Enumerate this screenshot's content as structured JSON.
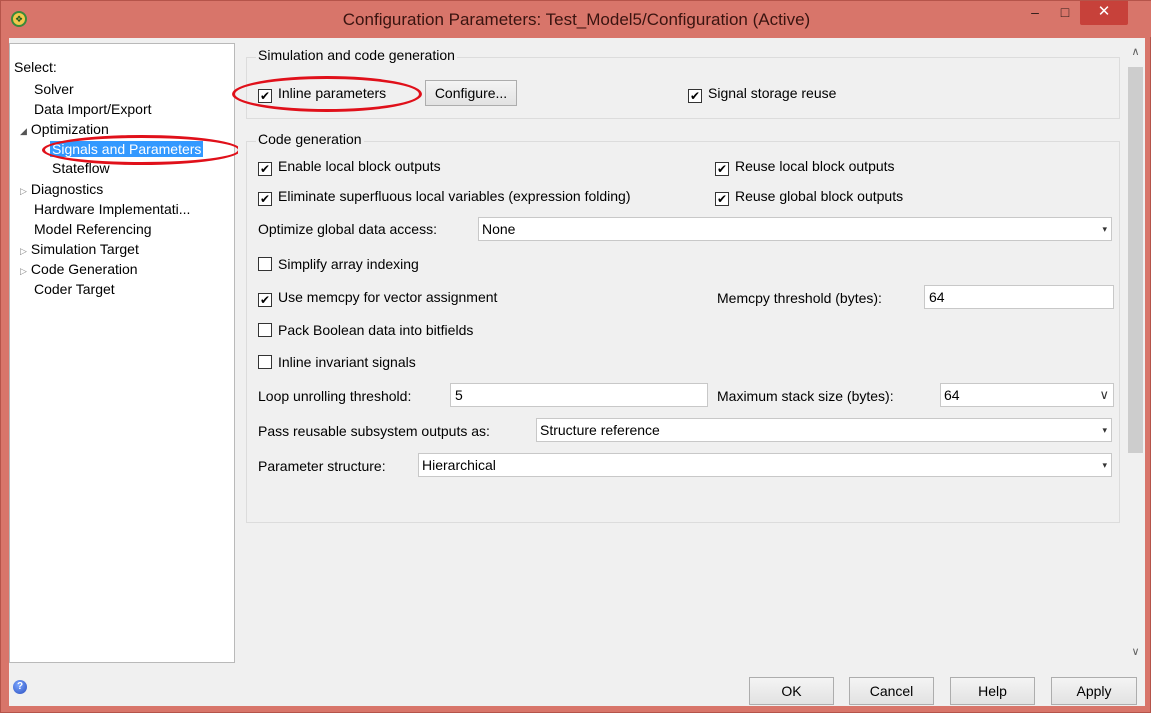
{
  "window": {
    "title": "Configuration Parameters: Test_Model5/Configuration (Active)",
    "minimize": "–",
    "maximize": "□",
    "close": "✕"
  },
  "tree": {
    "select_label": "Select:",
    "items": [
      {
        "label": "Solver",
        "indent": 0,
        "arrow": ""
      },
      {
        "label": "Data Import/Export",
        "indent": 0,
        "arrow": ""
      },
      {
        "label": "Optimization",
        "indent": 0,
        "arrow": "◢"
      },
      {
        "label": "Signals and Parameters",
        "indent": 1,
        "arrow": "",
        "selected": true
      },
      {
        "label": "Stateflow",
        "indent": 1,
        "arrow": ""
      },
      {
        "label": "Diagnostics",
        "indent": 0,
        "arrow": "▷"
      },
      {
        "label": "Hardware Implementati...",
        "indent": 0,
        "arrow": ""
      },
      {
        "label": "Model Referencing",
        "indent": 0,
        "arrow": ""
      },
      {
        "label": "Simulation Target",
        "indent": 0,
        "arrow": "▷"
      },
      {
        "label": "Code Generation",
        "indent": 0,
        "arrow": "▷"
      },
      {
        "label": "Coder Target",
        "indent": 0,
        "arrow": ""
      }
    ]
  },
  "sim_group": {
    "title": "Simulation and code generation",
    "inline_params": {
      "label": "Inline parameters",
      "checked": true
    },
    "configure_button": "Configure...",
    "signal_storage_reuse": {
      "label": "Signal storage reuse",
      "checked": true
    }
  },
  "code_group": {
    "title": "Code generation",
    "enable_local_block_outputs": {
      "label": "Enable local block outputs",
      "checked": true
    },
    "reuse_local_block_outputs": {
      "label": "Reuse local block outputs",
      "checked": true
    },
    "eliminate_superfluous": {
      "label": "Eliminate superfluous local variables (expression folding)",
      "checked": true
    },
    "reuse_global_block_outputs": {
      "label": "Reuse global block outputs",
      "checked": true
    },
    "optimize_global_label": "Optimize global data access:",
    "optimize_global_value": "None",
    "simplify_array_indexing": {
      "label": "Simplify array indexing",
      "checked": false
    },
    "use_memcpy": {
      "label": "Use memcpy for vector assignment",
      "checked": true
    },
    "memcpy_threshold_label": "Memcpy threshold (bytes):",
    "memcpy_threshold_value": "64",
    "pack_boolean": {
      "label": "Pack Boolean data into bitfields",
      "checked": false
    },
    "inline_invariant": {
      "label": "Inline invariant signals",
      "checked": false
    },
    "loop_unrolling_label": "Loop unrolling threshold:",
    "loop_unrolling_value": "5",
    "max_stack_label": "Maximum stack size (bytes):",
    "max_stack_value": "64",
    "pass_reusable_label": "Pass reusable subsystem outputs as:",
    "pass_reusable_value": "Structure reference",
    "param_structure_label": "Parameter structure:",
    "param_structure_value": "Hierarchical"
  },
  "buttons": {
    "ok": "OK",
    "cancel": "Cancel",
    "help": "Help",
    "apply": "Apply"
  },
  "icons": {
    "app": "simulink-icon",
    "help": "help-icon",
    "check": "✔",
    "dropdown_arrow": "▾",
    "combo_arrow": "∨"
  },
  "colors": {
    "titlebar": "#d8756a",
    "close": "#c7413a",
    "selection": "#3399ff",
    "annotation": "#e0101a"
  }
}
